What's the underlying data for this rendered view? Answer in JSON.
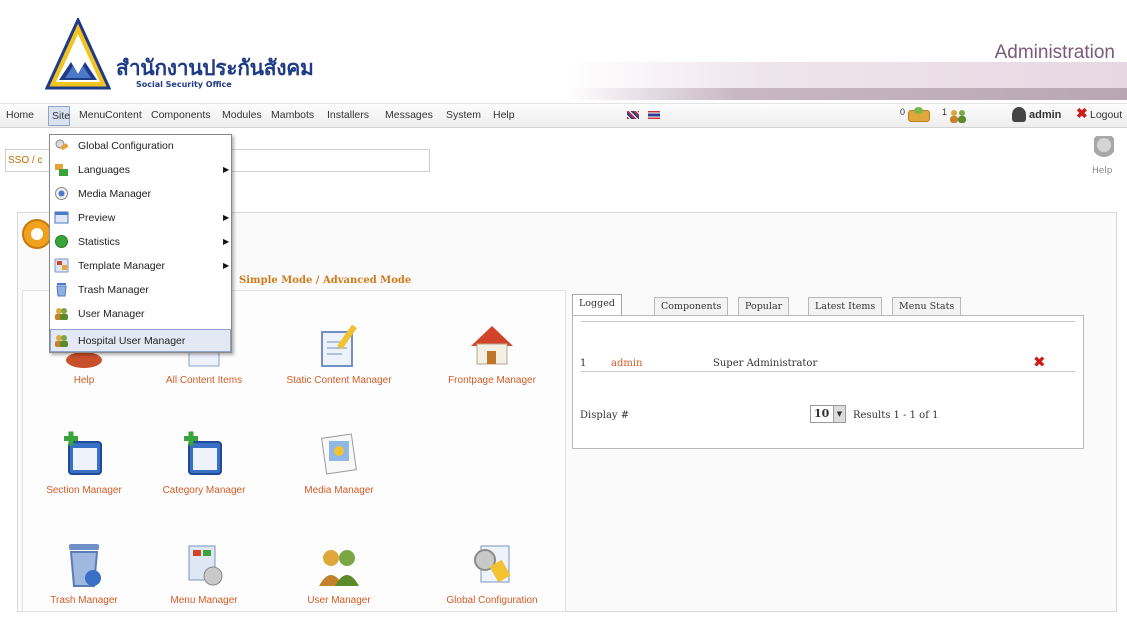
{
  "header": {
    "org_thai": "สำนักงานประกันสังคม",
    "org_english": "Social Security Office",
    "admin_title": "Administration"
  },
  "menubar": {
    "items": [
      "Home",
      "Site",
      "Menu",
      "Content",
      "Components",
      "Modules",
      "Mambots",
      "Installers",
      "Messages",
      "System",
      "Help"
    ],
    "messages_count": "0",
    "users_count": "1",
    "user_name": "admin",
    "logout_label": "Logout"
  },
  "pathway": {
    "text": "SSO / c"
  },
  "help_button": {
    "label": "Help"
  },
  "site_dropdown": {
    "items": [
      {
        "label": "Global Configuration",
        "icon": "global-configuration-icon",
        "submenu": false
      },
      {
        "label": "Languages",
        "icon": "languages-icon",
        "submenu": true
      },
      {
        "label": "Media Manager",
        "icon": "media-manager-icon",
        "submenu": false
      },
      {
        "label": "Preview",
        "icon": "preview-icon",
        "submenu": true
      },
      {
        "label": "Statistics",
        "icon": "statistics-icon",
        "submenu": true
      },
      {
        "label": "Template Manager",
        "icon": "template-manager-icon",
        "submenu": true
      },
      {
        "label": "Trash Manager",
        "icon": "trash-manager-icon",
        "submenu": false
      },
      {
        "label": "User Manager",
        "icon": "user-manager-icon",
        "submenu": false
      },
      {
        "label": "Hospital User Manager",
        "icon": "hospital-user-manager-icon",
        "submenu": false,
        "highlighted": true
      }
    ]
  },
  "control_panel": {
    "modes_text": "Simple Mode / Advanced Mode",
    "quick_icons": [
      {
        "label": "Help",
        "icon": "help-icon"
      },
      {
        "label": "All Content Items",
        "icon": "all-content-items-icon"
      },
      {
        "label": "Static Content Manager",
        "icon": "static-content-manager-icon"
      },
      {
        "label": "Frontpage Manager",
        "icon": "frontpage-manager-icon"
      },
      {
        "label": "Section Manager",
        "icon": "section-manager-icon"
      },
      {
        "label": "Category Manager",
        "icon": "category-manager-icon"
      },
      {
        "label": "Media Manager",
        "icon": "media-manager-icon"
      },
      {
        "label": "Trash Manager",
        "icon": "trash-manager-icon"
      },
      {
        "label": "Menu Manager",
        "icon": "menu-manager-icon"
      },
      {
        "label": "User Manager",
        "icon": "user-manager-icon"
      },
      {
        "label": "Global Configuration",
        "icon": "global-configuration-icon"
      }
    ]
  },
  "tabs": {
    "labels": [
      "Logged",
      "Components",
      "Popular",
      "Latest Items",
      "Menu Stats"
    ],
    "active": "Logged"
  },
  "logged_table": {
    "rows": [
      {
        "num": "1",
        "name": "admin",
        "role": "Super Administrator"
      }
    ],
    "display_label": "Display #",
    "display_value": "10",
    "results_text": "Results 1 - 1 of 1"
  },
  "colors": {
    "link_orange": "#d35c26",
    "brand_blue": "#1f3b86",
    "highlight_bg": "#e3e8f4",
    "delete_red": "#cc1b1b"
  }
}
